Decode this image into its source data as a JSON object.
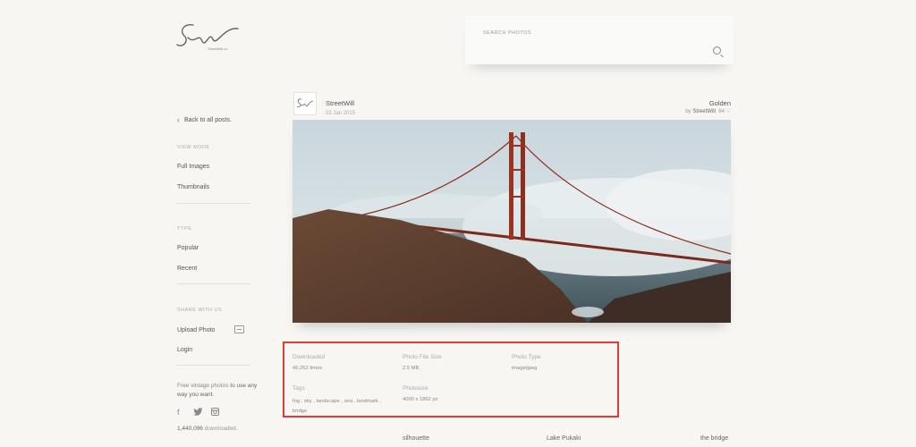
{
  "logo": {
    "mark": "Sw",
    "caption": "StreetWill.co"
  },
  "sidebar": {
    "back_label": "Back to all posts.",
    "view_mode_heading": "VIEW MODE",
    "view_mode_items": [
      "Full Images",
      "Thumbnails"
    ],
    "type_heading": "TYPE",
    "type_items": [
      "Popular",
      "Recent"
    ],
    "share_heading": "SHARE WITH US",
    "upload_label": "Upload Photo",
    "login_label": "Login",
    "free_text_a": "Free vintage photos ",
    "free_text_b": "to use any way you want.",
    "social_icons": [
      "facebook-icon",
      "twitter-icon",
      "instagram-icon"
    ],
    "download_count": "1,440,096",
    "download_suffix": " downloaded."
  },
  "search": {
    "label": "SEARCH PHOTOS",
    "value": "",
    "placeholder": ""
  },
  "post": {
    "author": "StreetWill",
    "date": "03 Jan 2015",
    "title": "Golden",
    "by_prefix": "by ",
    "by_author": "StreetWill",
    "likes": "84",
    "like_icon": "heart-icon"
  },
  "details": {
    "downloaded_label": "Downloaded",
    "downloaded_value": "45,262 times",
    "filesize_label": "Photo File Size",
    "filesize_value": "2.5 MB",
    "type_label": "Photo Type",
    "type_value": "image/jpeg",
    "tags_label": "Tags",
    "tags": [
      "fog",
      "sky",
      "landscape",
      "sea",
      "landmark",
      "bridge"
    ],
    "photosize_label": "Photosize",
    "photosize_value": "4000 x 1862 px"
  },
  "related": [
    "silhouette",
    "Lake Pukaki",
    "the bridge"
  ],
  "colors": {
    "highlight_border": "#e53935",
    "background": "#f7f6f3"
  }
}
